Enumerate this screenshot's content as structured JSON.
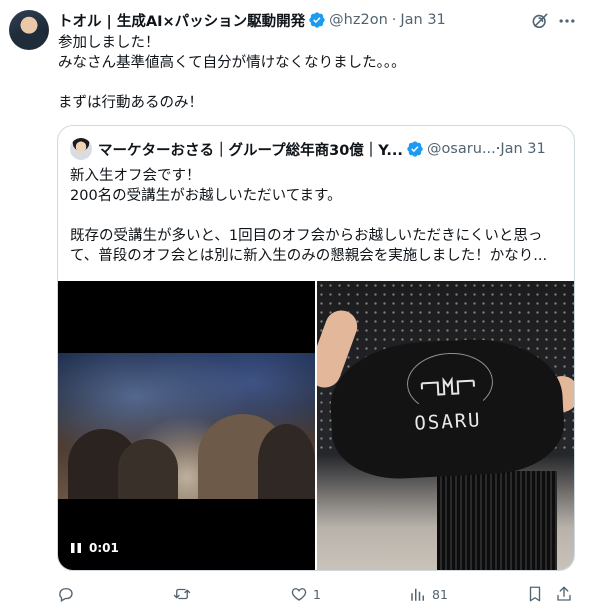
{
  "tweet": {
    "author_name": "トオル | 生成AI×パッション駆動開発",
    "handle": "@hz2on",
    "separator": "·",
    "date": "Jan 31",
    "lines": [
      "参加しました！",
      "みなさん基準値高くて自分が情けなくなりました。。。",
      "",
      "まずは行動あるのみ！"
    ]
  },
  "quote": {
    "author_name": "マーケターおさる｜グループ総年商30億｜Y...",
    "handle": "@osaru...",
    "separator": "·",
    "date": "Jan 31",
    "lines": [
      "新入生オフ会です！",
      "200名の受講生がお越しいただいてます。",
      "",
      "既存の受講生が多いと、1回目のオフ会からお越しいただきにくいと思っ",
      "て、普段のオフ会とは別に新入生のみの懇親会を実施しました！かなり..."
    ],
    "video": {
      "time": "0:01",
      "state": "playing"
    },
    "photo": {
      "mask_text": "OSARU"
    }
  },
  "actions": {
    "reply_count": "",
    "retweet_count": "",
    "like_count": "1",
    "views_count": "81"
  },
  "colors": {
    "text": "#0f1419",
    "muted": "#536471",
    "verified": "#1d9bf0",
    "border": "#cfd9de"
  },
  "icons": [
    "verified-badge-icon",
    "grok-icon",
    "more-icon",
    "pause-icon",
    "reply-icon",
    "retweet-icon",
    "like-icon",
    "views-icon",
    "bookmark-icon",
    "share-icon"
  ]
}
